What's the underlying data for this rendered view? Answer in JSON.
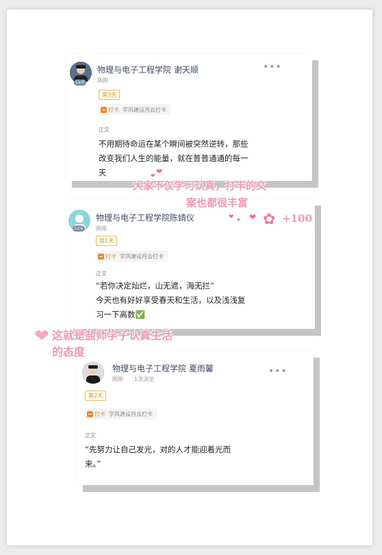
{
  "posts": [
    {
      "author": "物理与电子工程学院 谢天顺",
      "level": "Lv.0",
      "time": "刚刚",
      "day_badge": "第3天",
      "checkin_label": "打卡",
      "checkin_activity": "学风建设月云打卡",
      "section_label": "正文",
      "body_lines": [
        "不用期待命运在某个瞬间被突然逆转，那些",
        "改变我们人生的能量，就在普普通通的每一",
        "天"
      ]
    },
    {
      "author": "物理与电子工程学院陈婧仪",
      "level": "Lv.0",
      "time": "刚刚",
      "day_badge": "第1天",
      "checkin_label": "打卡",
      "checkin_activity": "学风建设月云打卡",
      "section_label": "正文",
      "body_lines": [
        "“若你决定灿烂，山无遮，海无拦”",
        "今天也有好好享受春天和生活，以及浅浅复",
        "习一下高数✅"
      ]
    },
    {
      "author": "物理与电子工程学院 夏雨馨",
      "time": "刚刚",
      "views": "1次浏览",
      "day_badge": "第2天",
      "checkin_label": "打卡",
      "checkin_activity": "学风建设月云打卡",
      "section_label": "正文",
      "body_lines": [
        "“先努力让自己发光，对的人才能迎着光而",
        "来。”"
      ]
    }
  ],
  "annotations": {
    "note_1_line_1": "大家不仅学习认真，打卡的文",
    "note_1_line_2": "案也都很丰富",
    "plus": "+100",
    "note_2_line_1": "这就是盐师学子认真生活",
    "note_2_line_2": "的态度"
  },
  "colors": {
    "accent": "#f08a24",
    "badge": "#d7a033",
    "handwriting": "#f29ab0",
    "name": "#3d4a6a"
  },
  "icons": [
    "more-icon",
    "checkin-calendar-icon",
    "heart-icon",
    "flower-icon",
    "user-icon"
  ]
}
